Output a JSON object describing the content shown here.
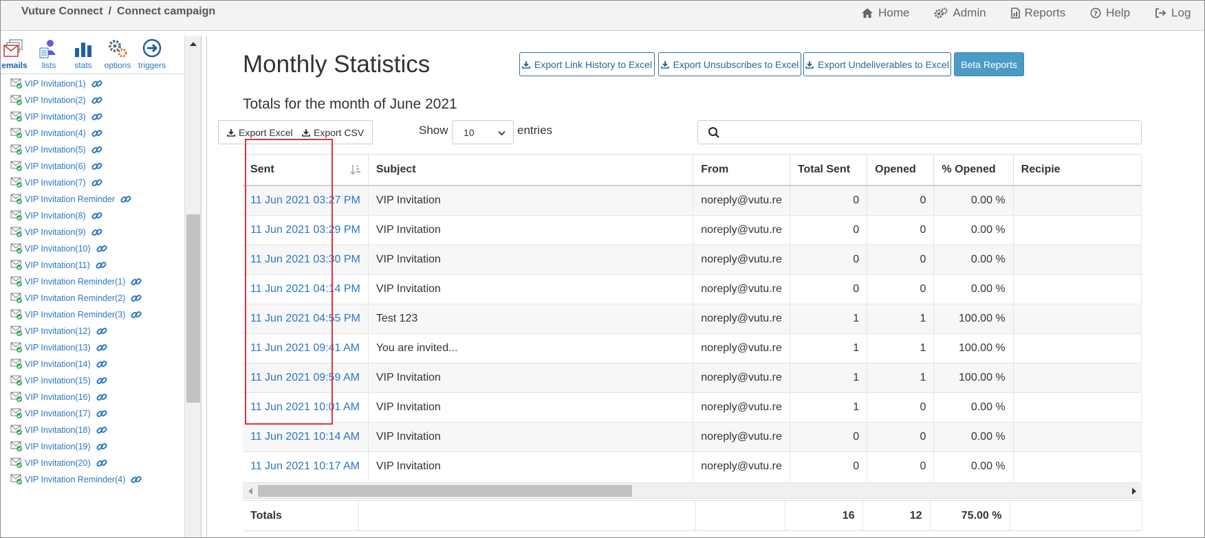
{
  "breadcrumb": {
    "app": "Vuture Connect",
    "separator": "/",
    "page": "Connect campaign"
  },
  "nav": [
    {
      "label": "Home",
      "icon": "home-icon"
    },
    {
      "label": "Admin",
      "icon": "gears-icon"
    },
    {
      "label": "Reports",
      "icon": "report-icon"
    },
    {
      "label": "Help",
      "icon": "help-icon"
    },
    {
      "label": "Log",
      "icon": "logout-icon"
    }
  ],
  "sidebar": {
    "tools": [
      {
        "label": "emails",
        "icon": "emails-icon",
        "active": true
      },
      {
        "label": "lists",
        "icon": "lists-icon"
      },
      {
        "label": "stats",
        "icon": "stats-icon"
      },
      {
        "label": "options",
        "icon": "options-icon"
      },
      {
        "label": "triggers",
        "icon": "triggers-icon"
      }
    ],
    "emails": [
      "VIP Invitation(1)",
      "VIP Invitation(2)",
      "VIP Invitation(3)",
      "VIP Invitation(4)",
      "VIP Invitation(5)",
      "VIP Invitation(6)",
      "VIP Invitation(7)",
      "VIP Invitation Reminder",
      "VIP Invitation(8)",
      "VIP Invitation(9)",
      "VIP Invitation(10)",
      "VIP Invitation(11)",
      "VIP Invitation Reminder(1)",
      "VIP Invitation Reminder(2)",
      "VIP Invitation Reminder(3)",
      "VIP Invitation(12)",
      "VIP Invitation(13)",
      "VIP Invitation(14)",
      "VIP Invitation(15)",
      "VIP Invitation(16)",
      "VIP Invitation(17)",
      "VIP Invitation(18)",
      "VIP Invitation(19)",
      "VIP Invitation(20)",
      "VIP Invitation Reminder(4)"
    ]
  },
  "main": {
    "title": "Monthly Statistics",
    "subtitle": "Totals for the month of June 2021",
    "buttons": {
      "export_links": "Export Link History to Excel",
      "export_unsubscribes": "Export Unsubscribes to Excel",
      "export_undeliverables": "Export Undeliverables to Excel",
      "beta_reports": "Beta Reports"
    },
    "datatable": {
      "export_excel": "Export Excel",
      "export_csv": "Export CSV",
      "show_label": "Show",
      "page_size": "10",
      "entries_label": "entries",
      "search_value": ""
    }
  },
  "table": {
    "columns": [
      "Sent",
      "Subject",
      "From",
      "Total Sent",
      "Opened",
      "% Opened",
      "Recipie"
    ],
    "rows": [
      [
        "11 Jun 2021 03:27 PM",
        "VIP Invitation",
        "noreply@vutu.re",
        "0",
        "0",
        "0.00 %"
      ],
      [
        "11 Jun 2021 03:29 PM",
        "VIP Invitation",
        "noreply@vutu.re",
        "0",
        "0",
        "0.00 %"
      ],
      [
        "11 Jun 2021 03:30 PM",
        "VIP Invitation",
        "noreply@vutu.re",
        "0",
        "0",
        "0.00 %"
      ],
      [
        "11 Jun 2021 04:14 PM",
        "VIP Invitation",
        "noreply@vutu.re",
        "0",
        "0",
        "0.00 %"
      ],
      [
        "11 Jun 2021 04:55 PM",
        "Test 123",
        "noreply@vutu.re",
        "1",
        "1",
        "100.00 %"
      ],
      [
        "11 Jun 2021 09:41 AM",
        "You are invited...",
        "noreply@vutu.re",
        "1",
        "1",
        "100.00 %"
      ],
      [
        "11 Jun 2021 09:59 AM",
        "VIP Invitation",
        "noreply@vutu.re",
        "1",
        "1",
        "100.00 %"
      ],
      [
        "11 Jun 2021 10:01 AM",
        "VIP Invitation",
        "noreply@vutu.re",
        "1",
        "0",
        "0.00 %"
      ],
      [
        "11 Jun 2021 10:14 AM",
        "VIP Invitation",
        "noreply@vutu.re",
        "0",
        "0",
        "0.00 %"
      ],
      [
        "11 Jun 2021 10:17 AM",
        "VIP Invitation",
        "noreply@vutu.re",
        "0",
        "0",
        "0.00 %"
      ]
    ],
    "totals": {
      "label": "Totals",
      "total_sent": "16",
      "opened": "12",
      "percent_opened": "75.00 %"
    }
  },
  "colors": {
    "link": "#2a76c5",
    "primary_button": "#4a9cc4",
    "highlight": "#e0323c"
  }
}
